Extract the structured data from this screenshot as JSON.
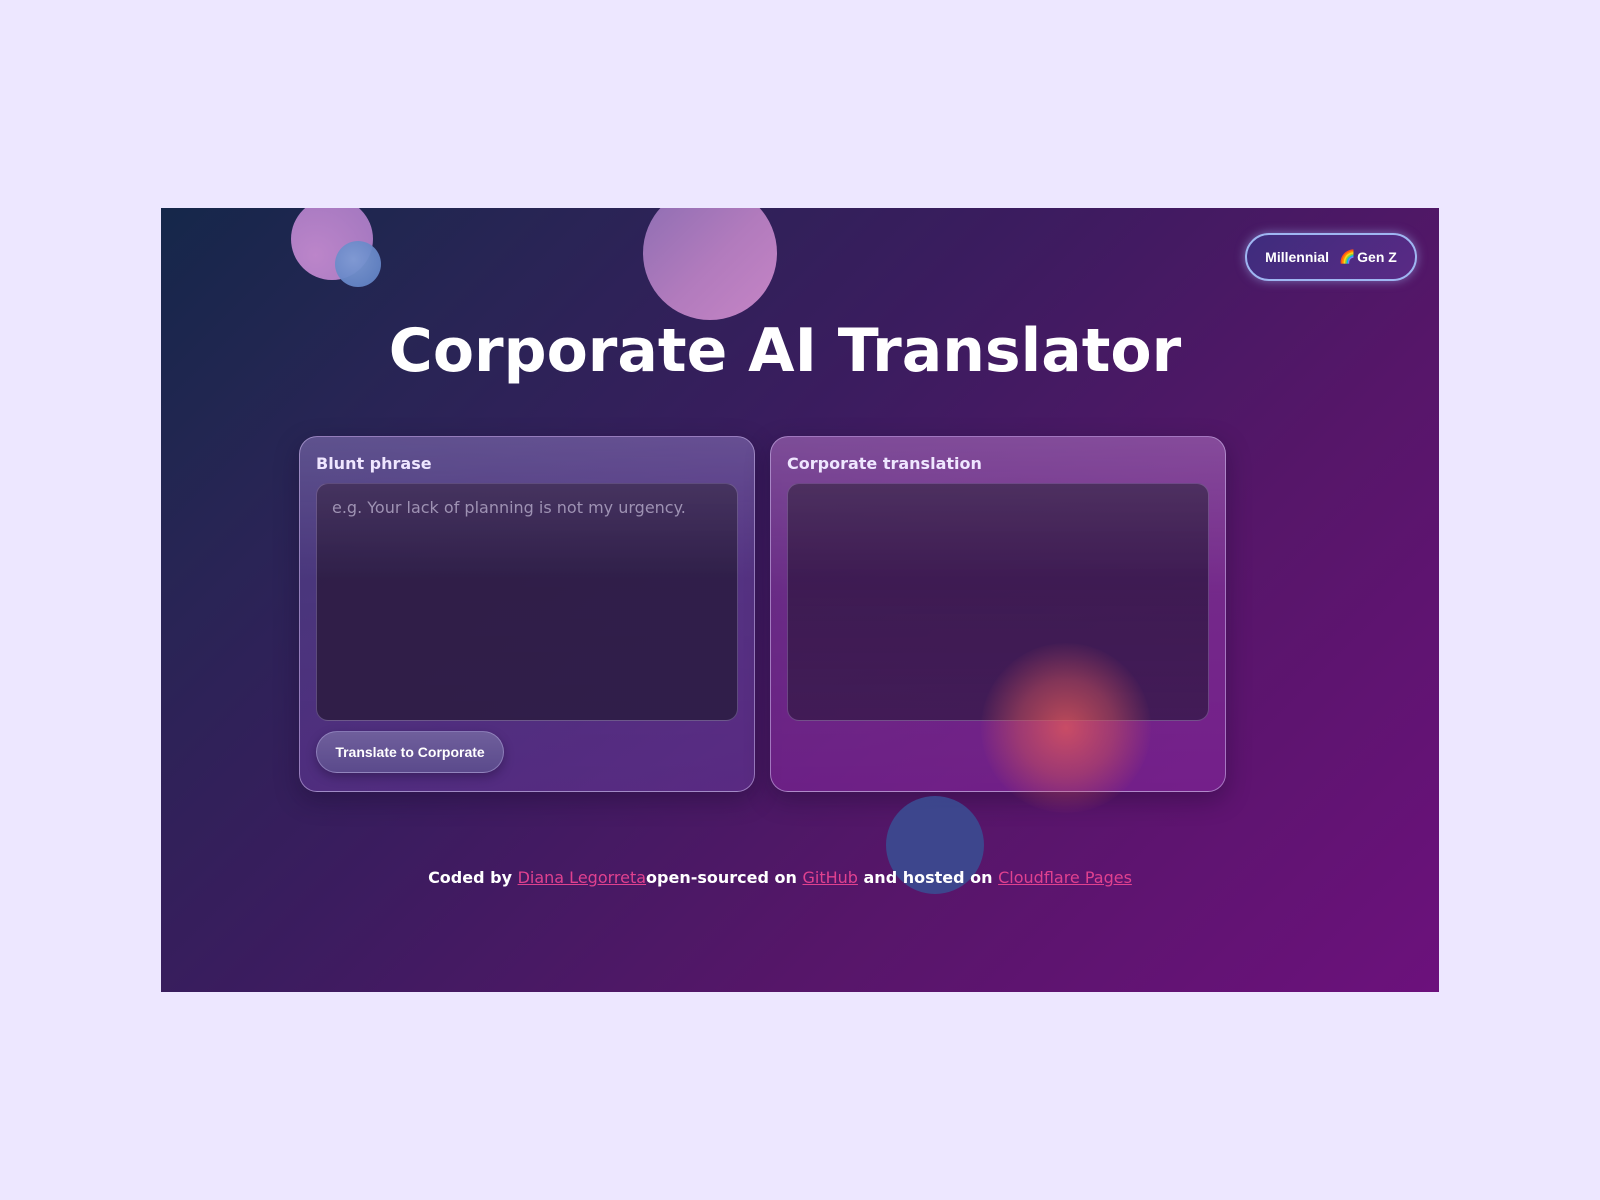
{
  "header": {
    "title": "Corporate AI Translator"
  },
  "toggle": {
    "left_label": "Millennial",
    "icon": "rainbow-icon",
    "icon_glyph": "🌈",
    "right_label": "Gen Z"
  },
  "input_panel": {
    "label": "Blunt phrase",
    "placeholder": "e.g. Your lack of planning is not my urgency.",
    "value": "",
    "button_label": "Translate to Corporate"
  },
  "output_panel": {
    "label": "Corporate translation",
    "value": ""
  },
  "footer": {
    "coded_by_text": "Coded by ",
    "author_link": "Diana Legorreta",
    "open_sourced_text": "open-sourced on ",
    "github_link": "GitHub",
    "hosted_text": " and hosted on ",
    "host_link": "Cloudflare Pages"
  },
  "colors": {
    "page_background": "#ede7ff",
    "link": "#e0418f",
    "toggle_border": "#9fb6f2"
  }
}
